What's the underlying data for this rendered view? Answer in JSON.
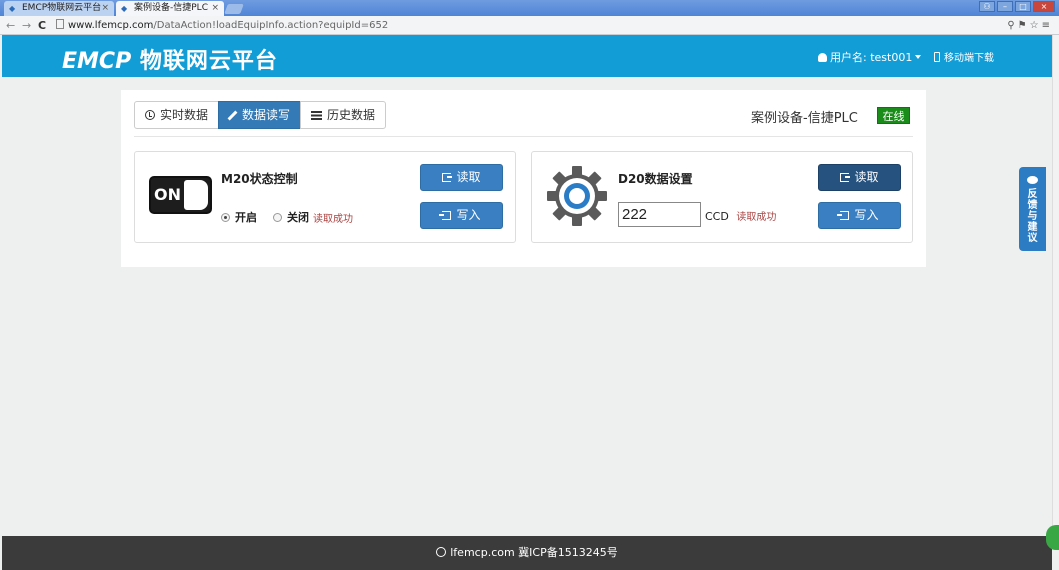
{
  "browser": {
    "tabs": [
      {
        "title": "EMCP物联网云平台",
        "active": false
      },
      {
        "title": "案例设备-信捷PLC",
        "active": true
      }
    ],
    "url_host": "www.lfemcp.com",
    "url_path": "/DataAction!loadEquipInfo.action?equipId=652"
  },
  "header": {
    "logo_mark": "EMCP",
    "logo_text": "物联网云平台",
    "user_label": "用户名: test001",
    "mobile_download": "移动端下载"
  },
  "tabs": [
    {
      "label": "实时数据",
      "icon": "clock-icon",
      "active": false
    },
    {
      "label": "数据读写",
      "icon": "pencil-icon",
      "active": true
    },
    {
      "label": "历史数据",
      "icon": "list-icon",
      "active": false
    }
  ],
  "device": {
    "title": "案例设备-信捷PLC",
    "status": "在线",
    "status_color": "#1a8c1a"
  },
  "cards": {
    "m20": {
      "title": "M20状态控制",
      "toggle_text": "ON",
      "radio_on_label": "开启",
      "radio_off_label": "关闭",
      "selected": "开启",
      "status_msg": "读取成功",
      "read_label": "读取",
      "write_label": "写入"
    },
    "d20": {
      "title": "D20数据设置",
      "value": "222",
      "unit": "CCD",
      "status_msg": "读取成功",
      "read_label": "读取",
      "write_label": "写入"
    }
  },
  "feedback": {
    "label": "反馈与建议"
  },
  "footer": {
    "text": "lfemcp.com 冀ICP备1513245号"
  },
  "colors": {
    "header_bg": "#139dd7",
    "primary": "#337ab7",
    "footer_bg": "#3b3b3b",
    "error_text": "#a94442"
  }
}
